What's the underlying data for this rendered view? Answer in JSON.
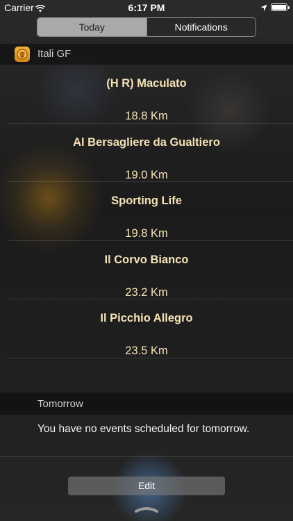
{
  "status_bar": {
    "carrier": "Carrier",
    "time": "6:17 PM"
  },
  "segmented": {
    "today_label": "Today",
    "notifications_label": "Notifications",
    "selected": "Today"
  },
  "widget": {
    "title": "Itali GF",
    "icon": "itali-gf-app-icon",
    "restaurants": [
      {
        "name": "(H R) Maculato",
        "distance": "18.8 Km"
      },
      {
        "name": "Al Bersagliere da Gualtiero",
        "distance": "19.0 Km"
      },
      {
        "name": "Sporting Life",
        "distance": "19.8 Km"
      },
      {
        "name": "Il Corvo Bianco",
        "distance": "23.2 Km"
      },
      {
        "name": "Il Picchio Allegro",
        "distance": "23.5 Km"
      }
    ]
  },
  "tomorrow": {
    "title": "Tomorrow",
    "message": "You have no events scheduled for tomorrow."
  },
  "edit_label": "Edit",
  "colors": {
    "accent_text": "#f5e3b5",
    "app_icon": "#e8a22c"
  }
}
